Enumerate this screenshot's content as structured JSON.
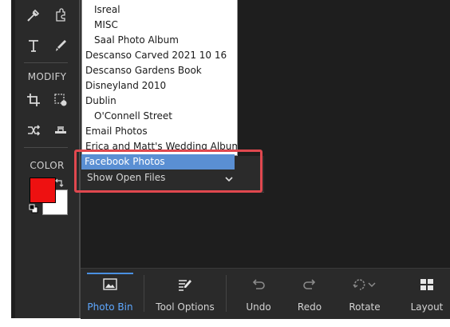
{
  "toolbox": {
    "modify_label": "MODIFY",
    "color_label": "COLOR",
    "fg_color": "#ee1111",
    "bg_color": "#ffffff"
  },
  "dropdown": {
    "items": [
      {
        "label": "Isreal",
        "level": 1
      },
      {
        "label": "MISC",
        "level": 1
      },
      {
        "label": "Saal Photo Album",
        "level": 1
      },
      {
        "label": "Descanso Carved 2021 10 16",
        "level": 0
      },
      {
        "label": "Descanso Gardens Book",
        "level": 0
      },
      {
        "label": "Disneyland 2010",
        "level": 0
      },
      {
        "label": "Dublin",
        "level": 0
      },
      {
        "label": "O'Connell Street",
        "level": 1
      },
      {
        "label": "Email Photos",
        "level": 0
      },
      {
        "label": "Erica and Matt's Wedding Album",
        "level": 0
      },
      {
        "label": "Facebook Photos",
        "level": 0,
        "selected": true
      }
    ]
  },
  "panel": {
    "show_open_files": "Show Open Files"
  },
  "bottom_bar": {
    "photo_bin": "Photo Bin",
    "tool_options": "Tool Options",
    "undo": "Undo",
    "redo": "Redo",
    "rotate": "Rotate",
    "layout": "Layout"
  },
  "colors": {
    "accent": "#5a8fd3",
    "highlight_box": "#e0484f",
    "active_tab": "#5ea8ff"
  }
}
